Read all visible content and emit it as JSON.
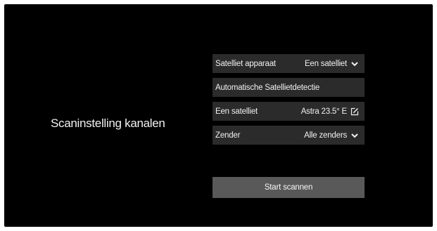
{
  "page": {
    "title": "Scaninstelling kanalen"
  },
  "settings": {
    "rows": [
      {
        "label": "Satelliet apparaat",
        "value": "Een satelliet",
        "icon": "chevron-down-icon"
      },
      {
        "label": "Automatische Satellietdetectie"
      },
      {
        "label": "Een satelliet",
        "value": "Astra 23.5° E",
        "icon": "edit-icon"
      },
      {
        "label": "Zender",
        "value": "Alle zenders",
        "icon": "chevron-down-icon"
      }
    ]
  },
  "actions": {
    "start_label": "Start scannen"
  },
  "colors": {
    "background": "#000000",
    "row": "#2b2b2b",
    "button": "#595959",
    "text": "#f0f0f0"
  }
}
